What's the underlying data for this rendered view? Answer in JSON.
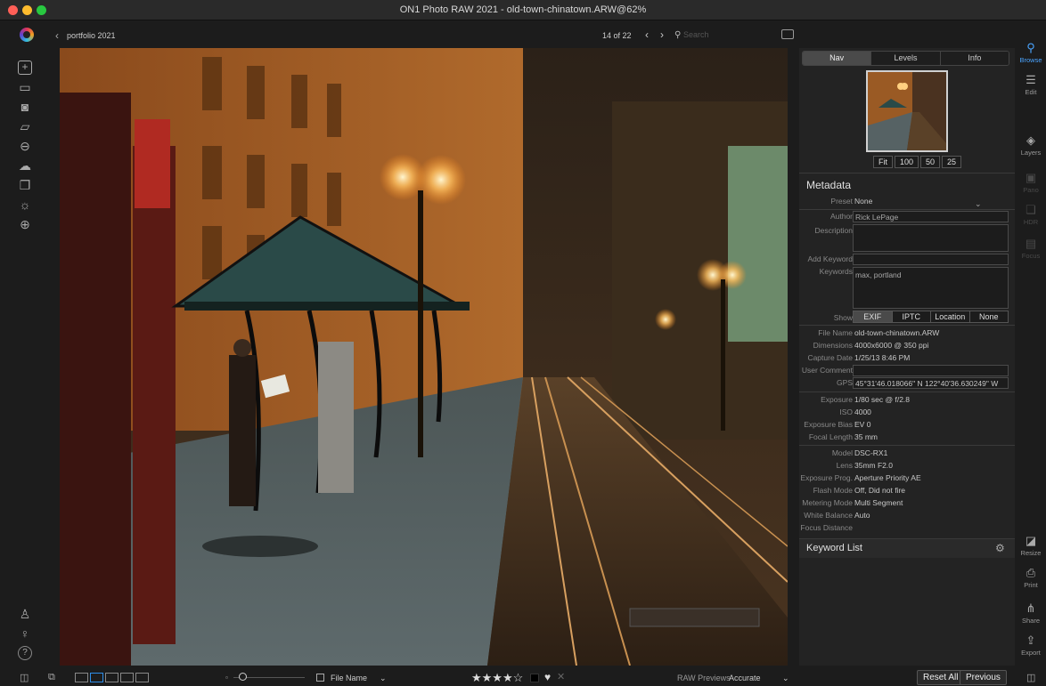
{
  "window": {
    "title": "ON1 Photo RAW 2021 - old-town-chinatown.ARW@62%"
  },
  "toolbar": {
    "album": "portfolio 2021",
    "counter": "14 of 22",
    "search_placeholder": "Search"
  },
  "nav_tabs": [
    "Nav",
    "Levels",
    "Info"
  ],
  "zoom_buttons": [
    "Fit",
    "100",
    "50",
    "25"
  ],
  "metadata": {
    "title": "Metadata",
    "preset_label": "Preset",
    "preset_value": "None",
    "author_label": "Author",
    "author_value": "Rick LePage",
    "description_label": "Description",
    "add_keyword_label": "Add Keyword",
    "keywords_label": "Keywords",
    "keywords_value": "max, portland",
    "show_label": "Show",
    "show_options": [
      "EXIF",
      "IPTC",
      "Location",
      "None"
    ],
    "file_name_label": "File Name",
    "file_name": "old-town-chinatown.ARW",
    "dimensions_label": "Dimensions",
    "dimensions": "4000x6000 @ 350 ppi",
    "capture_label": "Capture Date",
    "capture_date": "1/25/13 8:46 PM",
    "user_comment_label": "User Comment",
    "gps_label": "GPS",
    "gps": "45°31'46.018066\" N 122°40'36.630249\" W",
    "exposure_label": "Exposure",
    "exposure": "1/80 sec @ f/2.8",
    "iso_label": "ISO",
    "iso": "4000",
    "bias_label": "Exposure Bias",
    "bias": "EV 0",
    "focal_label": "Focal Length",
    "focal": "35 mm",
    "model_label": "Model",
    "model": "DSC-RX1",
    "lens_label": "Lens",
    "lens": "35mm F2.0",
    "prog_label": "Exposure Prog.",
    "prog": "Aperture Priority AE",
    "flash_label": "Flash Mode",
    "flash": "Off, Did not fire",
    "metering_label": "Metering Mode",
    "metering": "Multi Segment",
    "wb_label": "White Balance",
    "wb": "Auto",
    "focus_label": "Focus Distance"
  },
  "keyword_list": {
    "title": "Keyword List"
  },
  "modules": {
    "browse": "Browse",
    "edit": "Edit",
    "layers": "Layers",
    "pano": "Pano",
    "hdr": "HDR",
    "focus": "Focus",
    "resize": "Resize",
    "print": "Print",
    "share": "Share",
    "export": "Export"
  },
  "bottom": {
    "sort_label": "File Name",
    "rating_stars": "★★★★☆",
    "raw_previews_label": "RAW Previews",
    "raw_previews_value": "Accurate",
    "reset_all": "Reset All",
    "previous": "Previous"
  },
  "colors": {
    "accent": "#4aa4ff",
    "close": "#ff5f57",
    "minimize": "#febc2e",
    "zoom": "#28c840"
  }
}
